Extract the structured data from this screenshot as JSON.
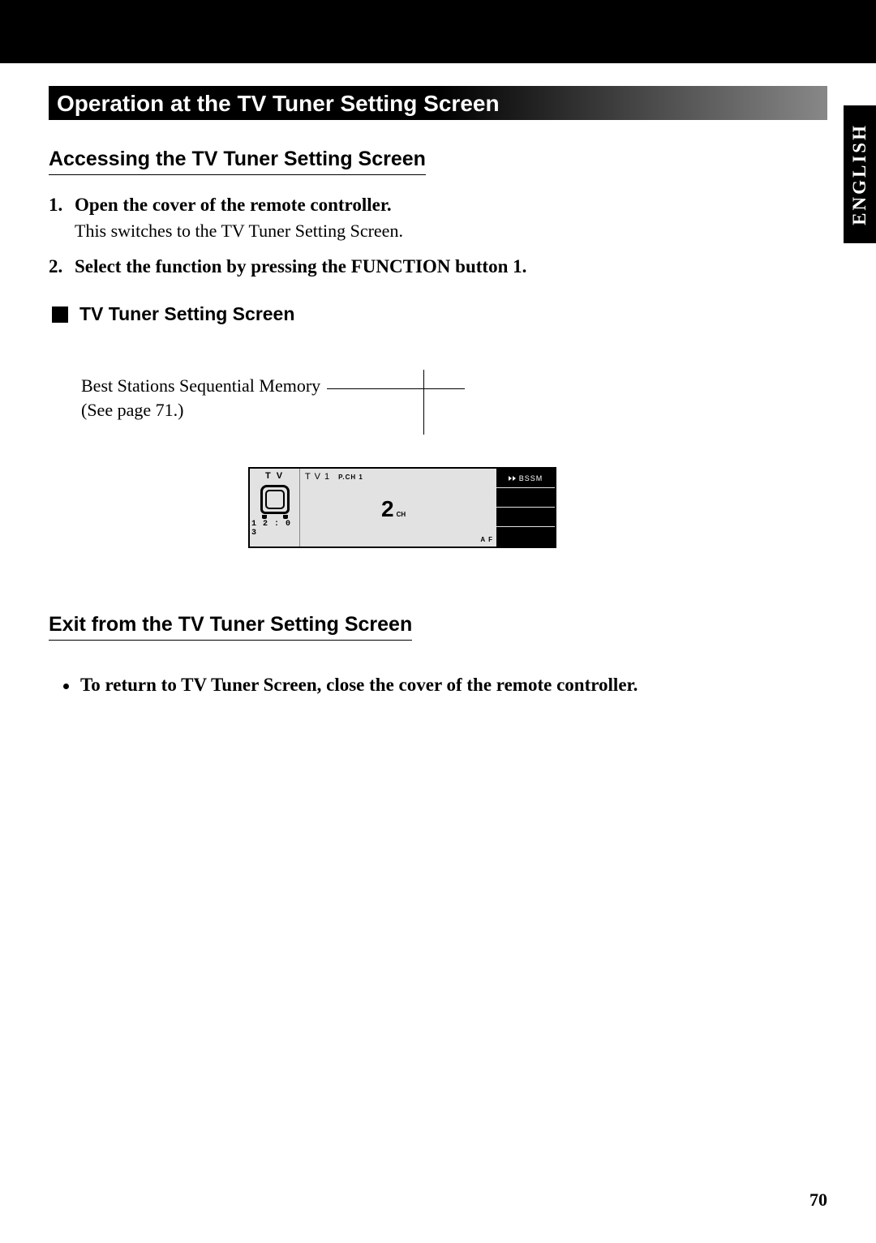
{
  "language_tab": "ENGLISH",
  "section_title": "Operation at the TV Tuner Setting Screen",
  "accessing": {
    "heading": "Accessing the TV Tuner Setting Screen",
    "step1_num": "1.",
    "step1_text": "Open the cover of the remote controller.",
    "step1_note": "This switches to the TV Tuner Setting Screen.",
    "step2_num": "2.",
    "step2_text": "Select the function by pressing the FUNCTION button 1."
  },
  "tuner_label": "TV Tuner Setting Screen",
  "annotation": {
    "line1": "Best Stations Sequential Memory",
    "line2": "(See page 71.)"
  },
  "screen": {
    "tv": "T V",
    "clock": "1 2 : 0 3",
    "tv1": "T V 1",
    "pch": "P.CH 1",
    "channel_num": "2",
    "channel_label": "CH",
    "af": "A F",
    "bssm": "BSSM"
  },
  "exit": {
    "heading": "Exit from the TV Tuner Setting Screen",
    "bullet": "To return to TV Tuner Screen, close the cover of the remote controller."
  },
  "page_number": "70"
}
